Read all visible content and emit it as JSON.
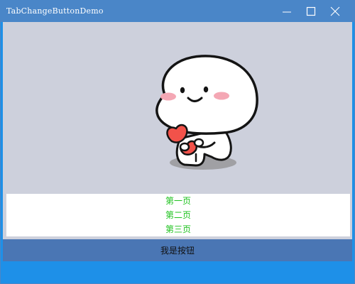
{
  "window": {
    "title": "TabChangeButtonDemo",
    "controls": {
      "minimize_icon": "minimize-icon",
      "maximize_icon": "maximize-icon",
      "close_icon": "close-icon"
    },
    "colors": {
      "titlebar": "#4a86c8",
      "content_background": "#cdd0dc",
      "tab_text": "#1ec21e",
      "button_background": "#4a76b4",
      "footer": "#1e90e8"
    }
  },
  "content": {
    "image": "sticker-character-holding-hearts"
  },
  "tabs": [
    {
      "label": "第一页"
    },
    {
      "label": "第二页"
    },
    {
      "label": "第三页"
    }
  ],
  "button": {
    "label": "我是按钮"
  }
}
